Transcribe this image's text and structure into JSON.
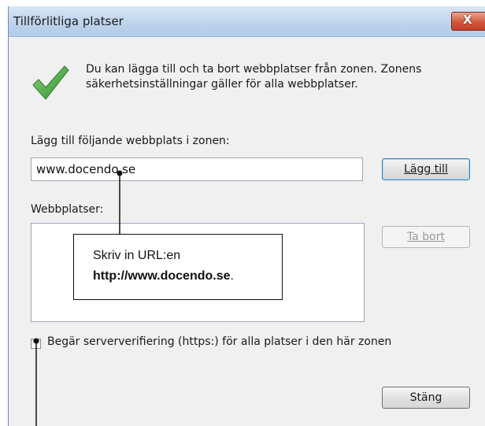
{
  "window": {
    "title": "Tillförlitliga platser",
    "close_glyph": "X"
  },
  "info": {
    "text": "Du kan lägga till och ta bort webbplatser från zonen. Zonens säkerhetsinställningar gäller för alla webbplatser.",
    "icon": "checkmark-icon"
  },
  "add": {
    "label": "Lägg till följande webbplats i zonen:",
    "value": "www.docendo.se",
    "button": "Lägg till"
  },
  "list": {
    "label": "Webbplatser:",
    "items": [],
    "remove_button": "Ta bort"
  },
  "https_checkbox": {
    "label": "Begär serververifiering (https:) för alla platser i den här zonen",
    "checked": false
  },
  "close_button": "Stäng",
  "annotation": {
    "line1": "Skriv in URL:en",
    "line2_bold": "http://www.docendo.se",
    "line2_suffix": "."
  },
  "colors": {
    "titlebar": "#bcd2ec",
    "close_red": "#c2402a",
    "check_green": "#3aa83a",
    "dialog_bg": "#f0f0f0"
  }
}
